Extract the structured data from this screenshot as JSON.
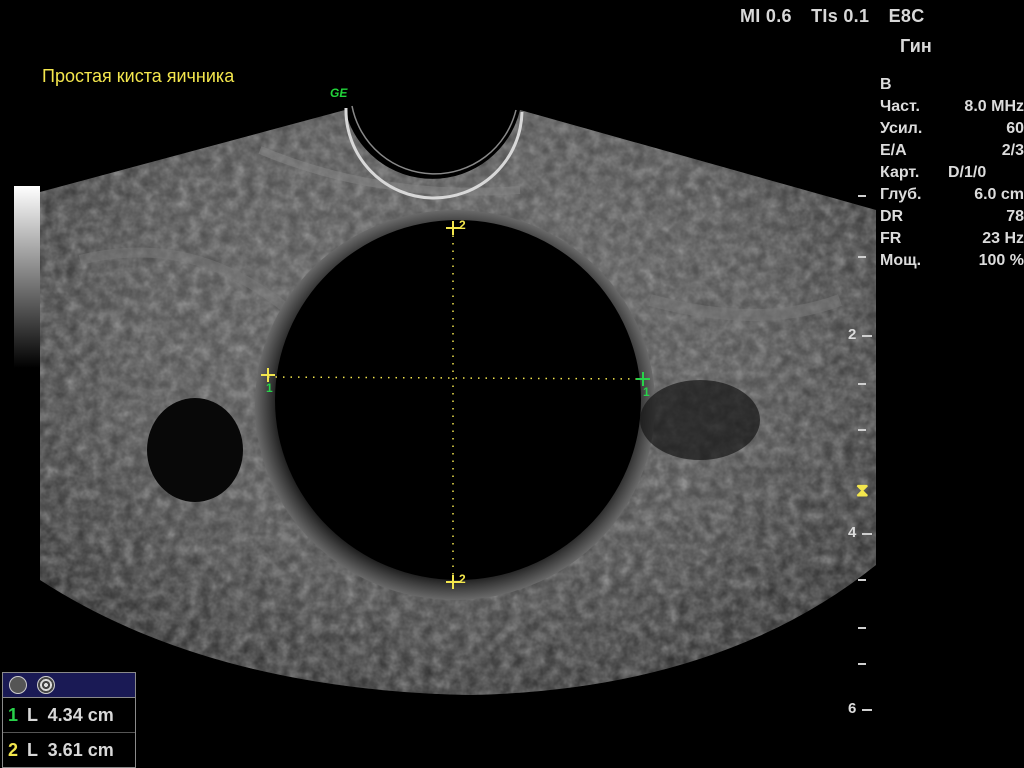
{
  "header": {
    "indices": [
      "MI 0.6",
      "TIs 0.1",
      "E8C"
    ],
    "preset": "Гин"
  },
  "annotation": {
    "label": "Простая киста яичника",
    "brand": "GE"
  },
  "parameters": [
    {
      "key": "B",
      "value": ""
    },
    {
      "key": "Част.",
      "value": "8.0 MHz"
    },
    {
      "key": "Усил.",
      "value": "60"
    },
    {
      "key": "E/A",
      "value": "2/3"
    },
    {
      "key": "Карт.",
      "value": "D/1/0"
    },
    {
      "key": "Глуб.",
      "value": "6.0 cm"
    },
    {
      "key": "DR",
      "value": "78"
    },
    {
      "key": "FR",
      "value": "23 Hz"
    },
    {
      "key": "Мощ.",
      "value": "100 %"
    }
  ],
  "depth_scale": {
    "labels": [
      "2",
      "4",
      "6"
    ]
  },
  "calipers": {
    "caliper1_label": "1",
    "caliper2_label": "2"
  },
  "measurements": [
    {
      "index": "1",
      "text": "L  4.34 cm",
      "color": "#28d24a"
    },
    {
      "index": "2",
      "text": "L  3.61 cm",
      "color": "#f3e64d"
    }
  ],
  "colors": {
    "annotation": "#f3e64d",
    "brand": "#22d43a",
    "caliper1": "#28d24a",
    "caliper2": "#f3e64d"
  }
}
